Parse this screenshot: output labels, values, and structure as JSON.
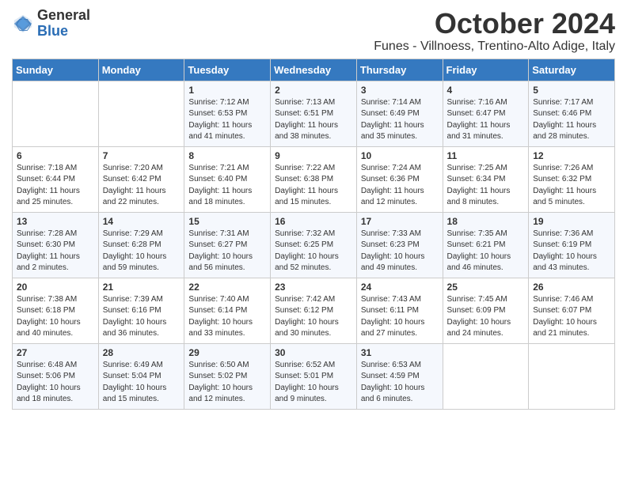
{
  "header": {
    "logo_line1": "General",
    "logo_line2": "Blue",
    "month_year": "October 2024",
    "location": "Funes - Villnoess, Trentino-Alto Adige, Italy"
  },
  "columns": [
    "Sunday",
    "Monday",
    "Tuesday",
    "Wednesday",
    "Thursday",
    "Friday",
    "Saturday"
  ],
  "weeks": [
    [
      {
        "day": "",
        "info": ""
      },
      {
        "day": "",
        "info": ""
      },
      {
        "day": "1",
        "info": "Sunrise: 7:12 AM\nSunset: 6:53 PM\nDaylight: 11 hours and 41 minutes."
      },
      {
        "day": "2",
        "info": "Sunrise: 7:13 AM\nSunset: 6:51 PM\nDaylight: 11 hours and 38 minutes."
      },
      {
        "day": "3",
        "info": "Sunrise: 7:14 AM\nSunset: 6:49 PM\nDaylight: 11 hours and 35 minutes."
      },
      {
        "day": "4",
        "info": "Sunrise: 7:16 AM\nSunset: 6:47 PM\nDaylight: 11 hours and 31 minutes."
      },
      {
        "day": "5",
        "info": "Sunrise: 7:17 AM\nSunset: 6:46 PM\nDaylight: 11 hours and 28 minutes."
      }
    ],
    [
      {
        "day": "6",
        "info": "Sunrise: 7:18 AM\nSunset: 6:44 PM\nDaylight: 11 hours and 25 minutes."
      },
      {
        "day": "7",
        "info": "Sunrise: 7:20 AM\nSunset: 6:42 PM\nDaylight: 11 hours and 22 minutes."
      },
      {
        "day": "8",
        "info": "Sunrise: 7:21 AM\nSunset: 6:40 PM\nDaylight: 11 hours and 18 minutes."
      },
      {
        "day": "9",
        "info": "Sunrise: 7:22 AM\nSunset: 6:38 PM\nDaylight: 11 hours and 15 minutes."
      },
      {
        "day": "10",
        "info": "Sunrise: 7:24 AM\nSunset: 6:36 PM\nDaylight: 11 hours and 12 minutes."
      },
      {
        "day": "11",
        "info": "Sunrise: 7:25 AM\nSunset: 6:34 PM\nDaylight: 11 hours and 8 minutes."
      },
      {
        "day": "12",
        "info": "Sunrise: 7:26 AM\nSunset: 6:32 PM\nDaylight: 11 hours and 5 minutes."
      }
    ],
    [
      {
        "day": "13",
        "info": "Sunrise: 7:28 AM\nSunset: 6:30 PM\nDaylight: 11 hours and 2 minutes."
      },
      {
        "day": "14",
        "info": "Sunrise: 7:29 AM\nSunset: 6:28 PM\nDaylight: 10 hours and 59 minutes."
      },
      {
        "day": "15",
        "info": "Sunrise: 7:31 AM\nSunset: 6:27 PM\nDaylight: 10 hours and 56 minutes."
      },
      {
        "day": "16",
        "info": "Sunrise: 7:32 AM\nSunset: 6:25 PM\nDaylight: 10 hours and 52 minutes."
      },
      {
        "day": "17",
        "info": "Sunrise: 7:33 AM\nSunset: 6:23 PM\nDaylight: 10 hours and 49 minutes."
      },
      {
        "day": "18",
        "info": "Sunrise: 7:35 AM\nSunset: 6:21 PM\nDaylight: 10 hours and 46 minutes."
      },
      {
        "day": "19",
        "info": "Sunrise: 7:36 AM\nSunset: 6:19 PM\nDaylight: 10 hours and 43 minutes."
      }
    ],
    [
      {
        "day": "20",
        "info": "Sunrise: 7:38 AM\nSunset: 6:18 PM\nDaylight: 10 hours and 40 minutes."
      },
      {
        "day": "21",
        "info": "Sunrise: 7:39 AM\nSunset: 6:16 PM\nDaylight: 10 hours and 36 minutes."
      },
      {
        "day": "22",
        "info": "Sunrise: 7:40 AM\nSunset: 6:14 PM\nDaylight: 10 hours and 33 minutes."
      },
      {
        "day": "23",
        "info": "Sunrise: 7:42 AM\nSunset: 6:12 PM\nDaylight: 10 hours and 30 minutes."
      },
      {
        "day": "24",
        "info": "Sunrise: 7:43 AM\nSunset: 6:11 PM\nDaylight: 10 hours and 27 minutes."
      },
      {
        "day": "25",
        "info": "Sunrise: 7:45 AM\nSunset: 6:09 PM\nDaylight: 10 hours and 24 minutes."
      },
      {
        "day": "26",
        "info": "Sunrise: 7:46 AM\nSunset: 6:07 PM\nDaylight: 10 hours and 21 minutes."
      }
    ],
    [
      {
        "day": "27",
        "info": "Sunrise: 6:48 AM\nSunset: 5:06 PM\nDaylight: 10 hours and 18 minutes."
      },
      {
        "day": "28",
        "info": "Sunrise: 6:49 AM\nSunset: 5:04 PM\nDaylight: 10 hours and 15 minutes."
      },
      {
        "day": "29",
        "info": "Sunrise: 6:50 AM\nSunset: 5:02 PM\nDaylight: 10 hours and 12 minutes."
      },
      {
        "day": "30",
        "info": "Sunrise: 6:52 AM\nSunset: 5:01 PM\nDaylight: 10 hours and 9 minutes."
      },
      {
        "day": "31",
        "info": "Sunrise: 6:53 AM\nSunset: 4:59 PM\nDaylight: 10 hours and 6 minutes."
      },
      {
        "day": "",
        "info": ""
      },
      {
        "day": "",
        "info": ""
      }
    ]
  ]
}
